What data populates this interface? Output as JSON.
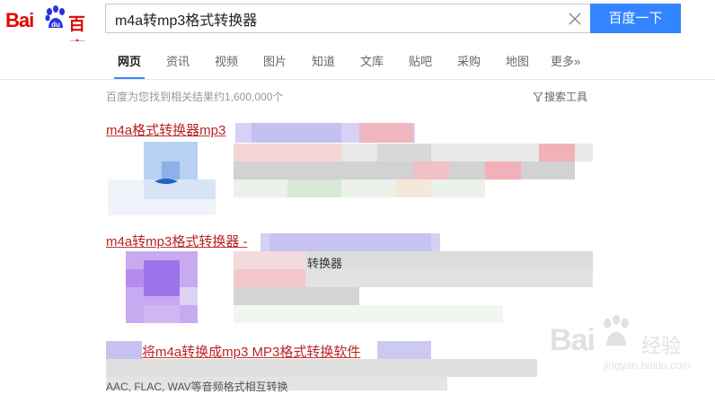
{
  "logo": {
    "bai": "Bai",
    "du": "du",
    "cn": "百度"
  },
  "search": {
    "query": "m4a转mp3格式转换器",
    "button_label": "百度一下"
  },
  "nav": {
    "tabs": [
      {
        "label": "网页",
        "active": true
      },
      {
        "label": "资讯"
      },
      {
        "label": "视频"
      },
      {
        "label": "图片"
      },
      {
        "label": "知道"
      },
      {
        "label": "文库"
      },
      {
        "label": "贴吧"
      },
      {
        "label": "采购"
      },
      {
        "label": "地图"
      },
      {
        "label": "更多»"
      }
    ]
  },
  "results_info": {
    "count_text": "百度为您找到相关结果约1,600,000个",
    "tools_label": "搜索工具"
  },
  "results": [
    {
      "title": "m4a格式转换器mp3"
    },
    {
      "title": "m4a转mp3格式转换器 -",
      "snippet_fragment": "转换器",
      "snippet_tail": ""
    },
    {
      "title": "将m4a转换成mp3 MP3格式转换软件",
      "snippet_start": "AAC, FLAC, WAV等音频格式相互转换"
    }
  ],
  "watermark": {
    "text": "Bai",
    "cn": "经验",
    "url": "jingyan.baidu.com"
  },
  "colors": {
    "accent": "#3385ff",
    "brand_red": "#e10601",
    "title_red": "#b82525"
  }
}
